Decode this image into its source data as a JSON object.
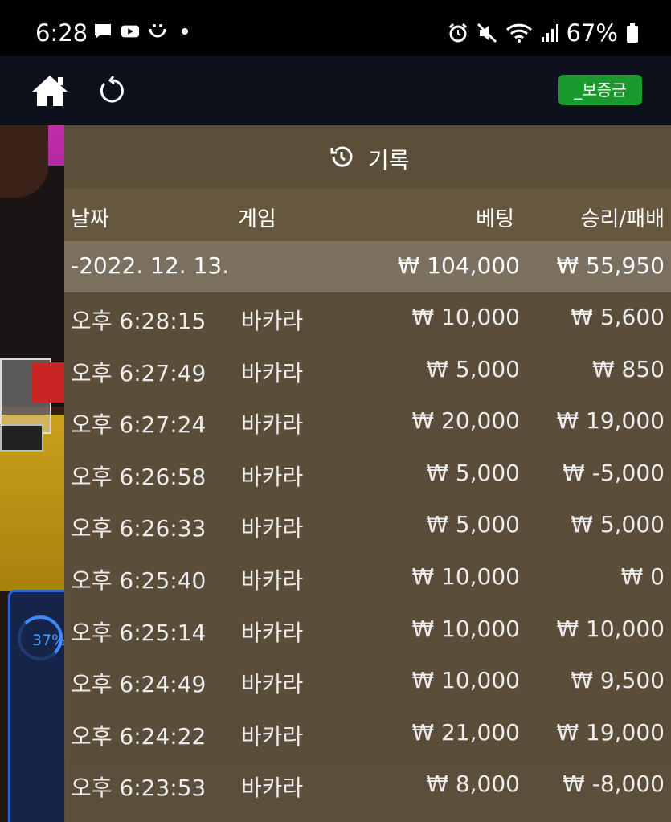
{
  "status_bar": {
    "time": "6:28",
    "left_icons": [
      "chat-icon",
      "youtube-icon",
      "face-app-icon",
      "dot-icon"
    ],
    "right_icons": [
      "alarm-icon",
      "mute-icon",
      "wifi-icon",
      "signal-icon",
      "battery-icon"
    ],
    "battery": "67%"
  },
  "nav": {
    "deposit_label": "_보증금",
    "accent": "#1a9a2c"
  },
  "video": {
    "progress_label": "37%",
    "progress_value": 0.37
  },
  "history": {
    "title": "기록",
    "columns": {
      "date": "날짜",
      "game": "게임",
      "bet": "베팅",
      "result": "승리/패배"
    },
    "summary": {
      "date": "-2022. 12. 13.",
      "bet": "₩ 104,000",
      "result": "₩ 55,950"
    },
    "rows": [
      {
        "time": "오후 6:28:15",
        "game": "바카라",
        "bet": "₩ 10,000",
        "result": "₩ 5,600"
      },
      {
        "time": "오후 6:27:49",
        "game": "바카라",
        "bet": "₩ 5,000",
        "result": "₩ 850"
      },
      {
        "time": "오후 6:27:24",
        "game": "바카라",
        "bet": "₩ 20,000",
        "result": "₩ 19,000"
      },
      {
        "time": "오후 6:26:58",
        "game": "바카라",
        "bet": "₩ 5,000",
        "result": "₩ -5,000"
      },
      {
        "time": "오후 6:26:33",
        "game": "바카라",
        "bet": "₩ 5,000",
        "result": "₩ 5,000"
      },
      {
        "time": "오후 6:25:40",
        "game": "바카라",
        "bet": "₩ 10,000",
        "result": "₩ 0"
      },
      {
        "time": "오후 6:25:14",
        "game": "바카라",
        "bet": "₩ 10,000",
        "result": "₩ 10,000"
      },
      {
        "time": "오후 6:24:49",
        "game": "바카라",
        "bet": "₩ 10,000",
        "result": "₩ 9,500"
      },
      {
        "time": "오후 6:24:22",
        "game": "바카라",
        "bet": "₩ 21,000",
        "result": "₩ 19,000"
      },
      {
        "time": "오후 6:23:53",
        "game": "바카라",
        "bet": "₩ 8,000",
        "result": "₩ -8,000"
      }
    ]
  }
}
